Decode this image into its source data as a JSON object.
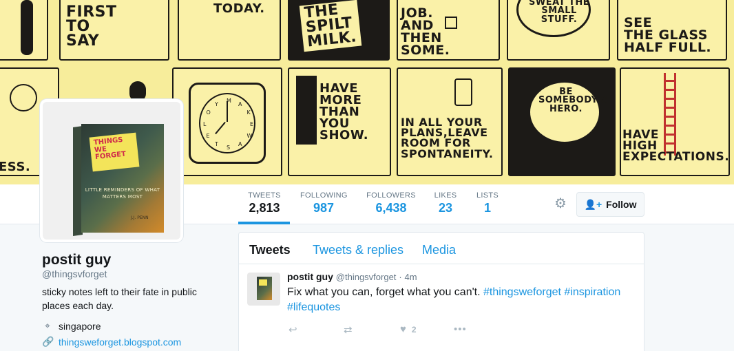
{
  "banner": {
    "panels": [
      {
        "text": "FIRST\nTO\nSAY"
      },
      {
        "text": "TODAY."
      },
      {
        "text": "THE\nSPILT\nMILK."
      },
      {
        "text": "JOB.\nAND\nTHEN\nSOME."
      },
      {
        "text": "SWEAT THE\nSMALL\nSTUFF."
      },
      {
        "text": "SEE\nTHE GLASS\nHALF FULL."
      },
      {
        "text": "ESS."
      },
      {
        "text": "HAVE\nMORE\nTHAN\nYOU\nSHOW."
      },
      {
        "text": "IN ALL YOUR\nPLANS,LEAVE\nROOM FOR\nSPONTANEITY."
      },
      {
        "text": "BE\nSOMEBODY'S\nHERO."
      },
      {
        "text": "HAVE\nHIGH\nEXPECTATIONS."
      }
    ],
    "watch_letters": [
      "M",
      "A",
      "K",
      "E",
      "W",
      "A",
      "S",
      "T",
      "E",
      "L",
      "O",
      "Y"
    ]
  },
  "avatar": {
    "book_title": "THINGS WE FORGET",
    "book_subtitle": "LITTLE REMINDERS OF WHAT MATTERS MOST",
    "book_author": "J.J. PENN"
  },
  "stats": [
    {
      "label": "TWEETS",
      "value": "2,813"
    },
    {
      "label": "FOLLOWING",
      "value": "987"
    },
    {
      "label": "FOLLOWERS",
      "value": "6,438"
    },
    {
      "label": "LIKES",
      "value": "23"
    },
    {
      "label": "LISTS",
      "value": "1"
    }
  ],
  "follow_button": {
    "label": "Follow",
    "icon": "add-user-icon"
  },
  "settings_icon": "gear-icon",
  "profile": {
    "name": "postit guy",
    "handle": "@thingsvforget",
    "bio": "sticky notes left to their fate in public places each day.",
    "location": "singapore",
    "location_icon": "location-pin-icon",
    "website": "thingsweforget.blogspot.com",
    "website_icon": "link-icon"
  },
  "timeline": {
    "tabs": [
      "Tweets",
      "Tweets & replies",
      "Media"
    ],
    "tweet": {
      "name": "postit guy",
      "handle": "@thingsvforget",
      "dot": "·",
      "time": "4m",
      "text_plain": "Fix what you can, forget what you can't. ",
      "hashtags": [
        "#thingsweforget",
        "#inspiration",
        "#lifequotes"
      ],
      "like_count": "2",
      "actions": [
        "reply-icon",
        "retweet-icon",
        "heart-icon",
        "more-icon"
      ]
    }
  },
  "colors": {
    "accent": "#1b95e0",
    "banner_bg": "#f7ed9b",
    "text": "#14171a",
    "muted": "#657786"
  }
}
